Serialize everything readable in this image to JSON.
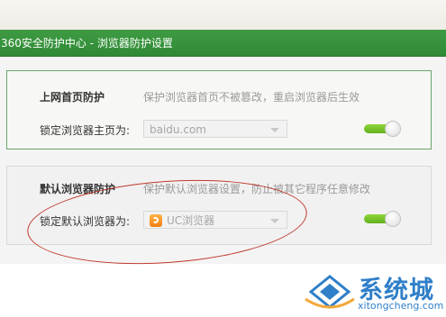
{
  "window": {
    "title": "360安全防护中心 - 浏览器防护设置"
  },
  "homepage_protection": {
    "title": "上网首页防护",
    "description": "保护浏览器首页不被篡改，重启浏览器后生效",
    "field_label": "锁定浏览器主页为:",
    "selected_value": "baidu.com",
    "toggle_on": true
  },
  "default_browser_protection": {
    "title": "默认浏览器防护",
    "description": "保护默认浏览器设置，防止被其它程序任意修改",
    "field_label": "锁定默认浏览器为:",
    "selected_value": "UC浏览器",
    "selected_icon": "uc-browser-icon",
    "toggle_on": true
  },
  "annotation": {
    "color": "#c0392b"
  },
  "watermark": {
    "site_name": "系统城",
    "url": "xitongcheng.com",
    "color": "#2f7fc8"
  },
  "colors": {
    "titlebar": "#3a9a3f",
    "toggle_on": "#70bc25"
  }
}
